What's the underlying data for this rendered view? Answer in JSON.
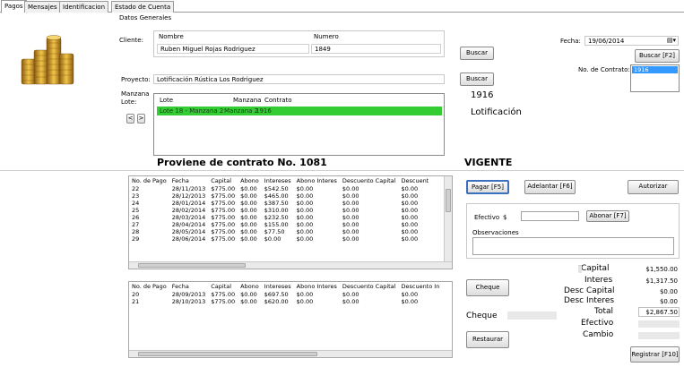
{
  "tabs": [
    {
      "label": "Pagos"
    },
    {
      "label": "Mensajes"
    },
    {
      "label": "Identificacion"
    },
    {
      "label": "Estado de Cuenta"
    }
  ],
  "header": {
    "section_title": "Datos Generales",
    "cliente_label": "Cliente:",
    "nombre_header": "Nombre",
    "numero_header": "Numero",
    "cliente_nombre": "Ruben Miguel Rojas Rodriguez",
    "cliente_numero": "1849",
    "buscar_label": "Buscar",
    "proyecto_label": "Proyecto:",
    "proyecto_value": "Lotificación Rústica Los Rodriguez",
    "manzana_label": "Manzana",
    "lote_label": "Lote:",
    "lote_headers": [
      "Lote",
      "Manzana",
      "Contrato"
    ],
    "lote_selected": [
      "Lote 18 - Manzana 2",
      "Manzana 2",
      "1916"
    ],
    "nav_prev": "<",
    "nav_next": ">",
    "contract_number": "1916",
    "lotificacion": "Lotificación",
    "proviene": "Proviene de contrato No. 1081",
    "vigente": "VIGENTE",
    "fecha_label": "Fecha:",
    "fecha_value": "19/06/2014",
    "buscar_f2": "Buscar [F2]",
    "no_contrato_label": "No. de Contrato:",
    "no_contrato_value": "1916"
  },
  "pending_table": {
    "headers": [
      "No. de Pago",
      "Fecha",
      "Capital",
      "Abono",
      "Intereses",
      "Abono Interes",
      "Descuento Capital",
      "Descuent"
    ],
    "rows": [
      [
        "22",
        "28/11/2013",
        "$775.00",
        "$0.00",
        "$542.50",
        "$0.00",
        "$0.00",
        "$0.00"
      ],
      [
        "23",
        "28/12/2013",
        "$775.00",
        "$0.00",
        "$465.00",
        "$0.00",
        "$0.00",
        "$0.00"
      ],
      [
        "24",
        "28/01/2014",
        "$775.00",
        "$0.00",
        "$387.50",
        "$0.00",
        "$0.00",
        "$0.00"
      ],
      [
        "25",
        "28/02/2014",
        "$775.00",
        "$0.00",
        "$310.00",
        "$0.00",
        "$0.00",
        "$0.00"
      ],
      [
        "26",
        "28/03/2014",
        "$775.00",
        "$0.00",
        "$232.50",
        "$0.00",
        "$0.00",
        "$0.00"
      ],
      [
        "27",
        "28/04/2014",
        "$775.00",
        "$0.00",
        "$155.00",
        "$0.00",
        "$0.00",
        "$0.00"
      ],
      [
        "28",
        "28/05/2014",
        "$775.00",
        "$0.00",
        "$77.50",
        "$0.00",
        "$0.00",
        "$0.00"
      ],
      [
        "29",
        "28/06/2014",
        "$775.00",
        "$0.00",
        "$0.00",
        "$0.00",
        "$0.00",
        "$0.00"
      ]
    ]
  },
  "selected_table": {
    "headers": [
      "No. de Pago",
      "Fecha",
      "Capital",
      "Abono",
      "Intereses",
      "Abono Interes",
      "Descuento Capital",
      "Descuento In"
    ],
    "rows": [
      [
        "20",
        "28/09/2013",
        "$775.00",
        "$0.00",
        "$697.50",
        "$0.00",
        "$0.00",
        "$0.00"
      ],
      [
        "21",
        "28/10/2013",
        "$775.00",
        "$0.00",
        "$620.00",
        "$0.00",
        "$0.00",
        "$0.00"
      ]
    ]
  },
  "actions": {
    "pagar": "Pagar [F5]",
    "adelantar": "Adelantar [F6]",
    "autorizar": "Autorizar",
    "efectivo_label": "Efectivo",
    "currency": "$",
    "abonar": "Abonar [F7]",
    "observaciones_label": "Observaciones",
    "cheque_button": "Cheque",
    "cheque_label": "Cheque",
    "restaurar": "Restaurar",
    "registrar": "Registrar [F10]"
  },
  "summary": {
    "capital_label": "Capital",
    "capital_value": "$1,550.00",
    "interes_label": "Interes",
    "interes_value": "$1,317.50",
    "desc_capital_label": "Desc Capital",
    "desc_capital_value": "$0.00",
    "desc_interes_label": "Desc Interes",
    "desc_interes_value": "$0.00",
    "total_label": "Total",
    "total_value": "$2,867.50",
    "efectivo_label": "Efectivo",
    "cambio_label": "Cambio"
  },
  "colors": {
    "selection_green": "#33cc33",
    "selection_blue": "#3399ff",
    "coin_gold": "#d9a520"
  }
}
